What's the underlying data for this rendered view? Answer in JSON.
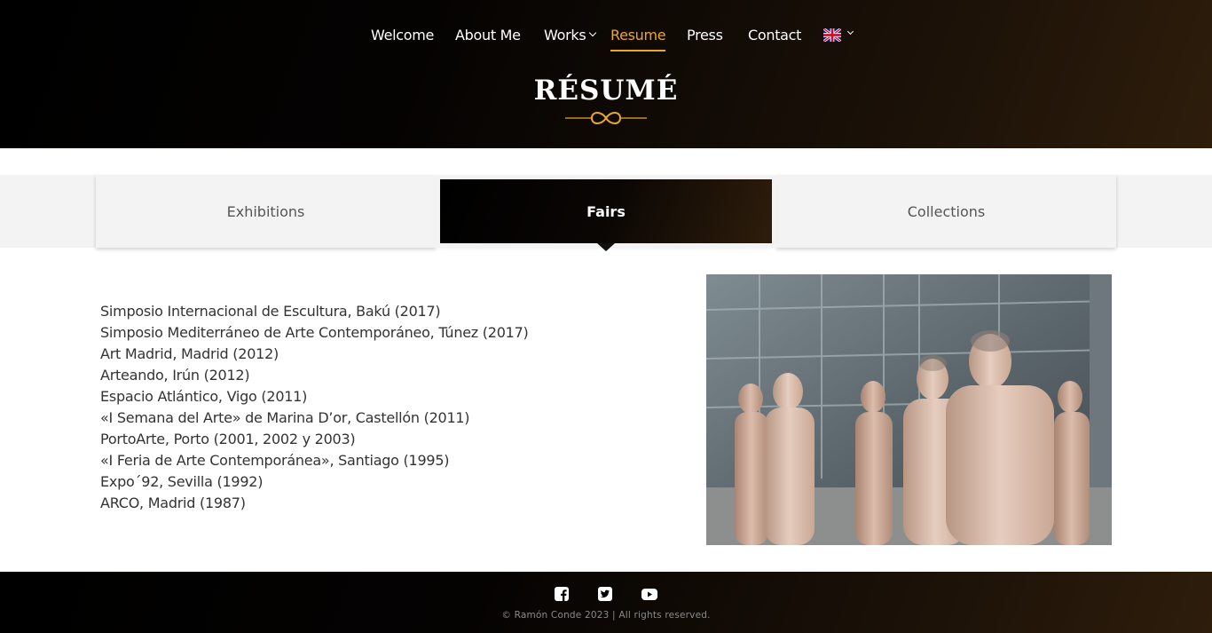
{
  "nav": {
    "items": [
      {
        "label": "Welcome"
      },
      {
        "label": "About Me"
      },
      {
        "label": "Works"
      },
      {
        "label": "Resume"
      },
      {
        "label": "Press"
      },
      {
        "label": "Contact"
      }
    ],
    "active": "Resume",
    "language_flag": "uk-flag-icon"
  },
  "page_title": "RÉSUMÉ",
  "tabs": [
    {
      "label": "Exhibitions"
    },
    {
      "label": "Fairs"
    },
    {
      "label": "Collections"
    }
  ],
  "active_tab": "Fairs",
  "fairs": [
    "Simposio Internacional de Escultura, Bakú (2017)",
    "Simposio Mediterráneo de Arte Contemporáneo, Túnez (2017)",
    "Art Madrid, Madrid (2012)",
    "Arteando, Irún (2012)",
    "Espacio Atlántico, Vigo (2011)",
    "«I Semana del Arte» de Marina D’or, Castellón (2011)",
    "PortoArte, Porto (2001, 2002 y 2003)",
    "«I Feria de Arte Contemporánea», Santiago (1995)",
    "Expo´92, Sevilla (1992)",
    "ARCO, Madrid (1987)"
  ],
  "footer": {
    "social": [
      "facebook-icon",
      "twitter-icon",
      "youtube-icon"
    ],
    "copyright": "© Ramón Conde 2023 | All rights reserved."
  },
  "colors": {
    "accent": "#e9a829",
    "header_dark": "#000000",
    "header_brown": "#2e1d0b",
    "tab_bg": "#f3f3f3"
  }
}
